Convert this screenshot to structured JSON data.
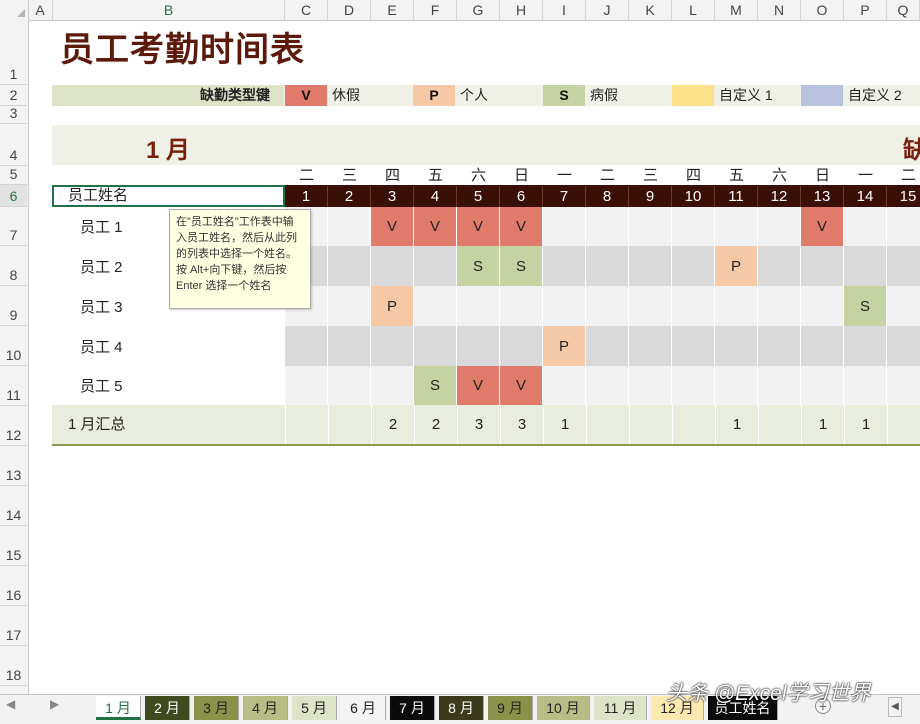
{
  "title": "员工考勤时间表",
  "columns": [
    "A",
    "B",
    "C",
    "D",
    "E",
    "F",
    "G",
    "H",
    "I",
    "J",
    "K",
    "L",
    "M",
    "N",
    "O",
    "P",
    "Q"
  ],
  "rows": [
    "1",
    "2",
    "3",
    "4",
    "5",
    "6",
    "7",
    "8",
    "9",
    "10",
    "11",
    "12",
    "13",
    "14",
    "15",
    "16",
    "17",
    "18"
  ],
  "legend": {
    "label": "缺勤类型键",
    "items": [
      {
        "key": "V",
        "text": "休假",
        "color": "#e07a6b"
      },
      {
        "key": "P",
        "text": "个人",
        "color": "#f5c8a6"
      },
      {
        "key": "S",
        "text": "病假",
        "color": "#c5d3a2"
      },
      {
        "key": "",
        "text": "自定义 1",
        "color": "#fde08a"
      },
      {
        "key": "",
        "text": "自定义 2",
        "color": "#b7c3df"
      }
    ]
  },
  "month": "1 月",
  "month_right": "缺",
  "weekdays": [
    "二",
    "三",
    "四",
    "五",
    "六",
    "日",
    "一",
    "二",
    "三",
    "四",
    "五",
    "六",
    "日",
    "一",
    "二"
  ],
  "days": [
    "1",
    "2",
    "3",
    "4",
    "5",
    "6",
    "7",
    "8",
    "9",
    "10",
    "11",
    "12",
    "13",
    "14",
    "15"
  ],
  "name_header": "员工姓名",
  "employees": [
    {
      "name": "员工 1",
      "marks": [
        "",
        "",
        "V",
        "V",
        "V",
        "V",
        "",
        "",
        "",
        "",
        "",
        "",
        "V",
        "",
        ""
      ]
    },
    {
      "name": "员工 2",
      "marks": [
        "",
        "",
        "",
        "",
        "S",
        "S",
        "",
        "",
        "",
        "",
        "P",
        "",
        "",
        "",
        ""
      ]
    },
    {
      "name": "员工 3",
      "marks": [
        "",
        "",
        "P",
        "",
        "",
        "",
        "",
        "",
        "",
        "",
        "",
        "",
        "",
        "S",
        ""
      ]
    },
    {
      "name": "员工 4",
      "marks": [
        "",
        "",
        "",
        "",
        "",
        "",
        "P",
        "",
        "",
        "",
        "",
        "",
        "",
        "",
        ""
      ]
    },
    {
      "name": "员工 5",
      "marks": [
        "",
        "",
        "",
        "S",
        "V",
        "V",
        "",
        "",
        "",
        "",
        "",
        "",
        "",
        "",
        ""
      ]
    }
  ],
  "total_label": "1 月汇总",
  "totals": [
    "",
    "",
    "2",
    "2",
    "3",
    "3",
    "1",
    "",
    "",
    "",
    "1",
    "",
    "1",
    "1",
    ""
  ],
  "tooltip": "在\"员工姓名\"工作表中输入员工姓名，然后从此列的列表中选择一个姓名。按 Alt+向下键，然后按 Enter 选择一个姓名",
  "tabs": [
    {
      "label": "1 月",
      "bg": "#ffffff",
      "fg": "#217346",
      "active": true
    },
    {
      "label": "2 月",
      "bg": "#404a1f",
      "fg": "#ffffff"
    },
    {
      "label": "3 月",
      "bg": "#8a9148",
      "fg": "#222222"
    },
    {
      "label": "4 月",
      "bg": "#b7bd85",
      "fg": "#222222"
    },
    {
      "label": "5 月",
      "bg": "#dde3c7",
      "fg": "#222222"
    },
    {
      "label": "6 月",
      "bg": "#f4f4f4",
      "fg": "#222222"
    },
    {
      "label": "7 月",
      "bg": "#0b0b0b",
      "fg": "#ffffff"
    },
    {
      "label": "8 月",
      "bg": "#3b3b1c",
      "fg": "#ffffff"
    },
    {
      "label": "9 月",
      "bg": "#8a9148",
      "fg": "#222222"
    },
    {
      "label": "10 月",
      "bg": "#b7bd85",
      "fg": "#222222"
    },
    {
      "label": "11 月",
      "bg": "#dde3c7",
      "fg": "#222222"
    },
    {
      "label": "12 月",
      "bg": "#fde9b0",
      "fg": "#222222"
    },
    {
      "label": "员工姓名",
      "bg": "#0b0b0b",
      "fg": "#ffffff"
    }
  ],
  "watermark": "头条 @Excel学习世界"
}
